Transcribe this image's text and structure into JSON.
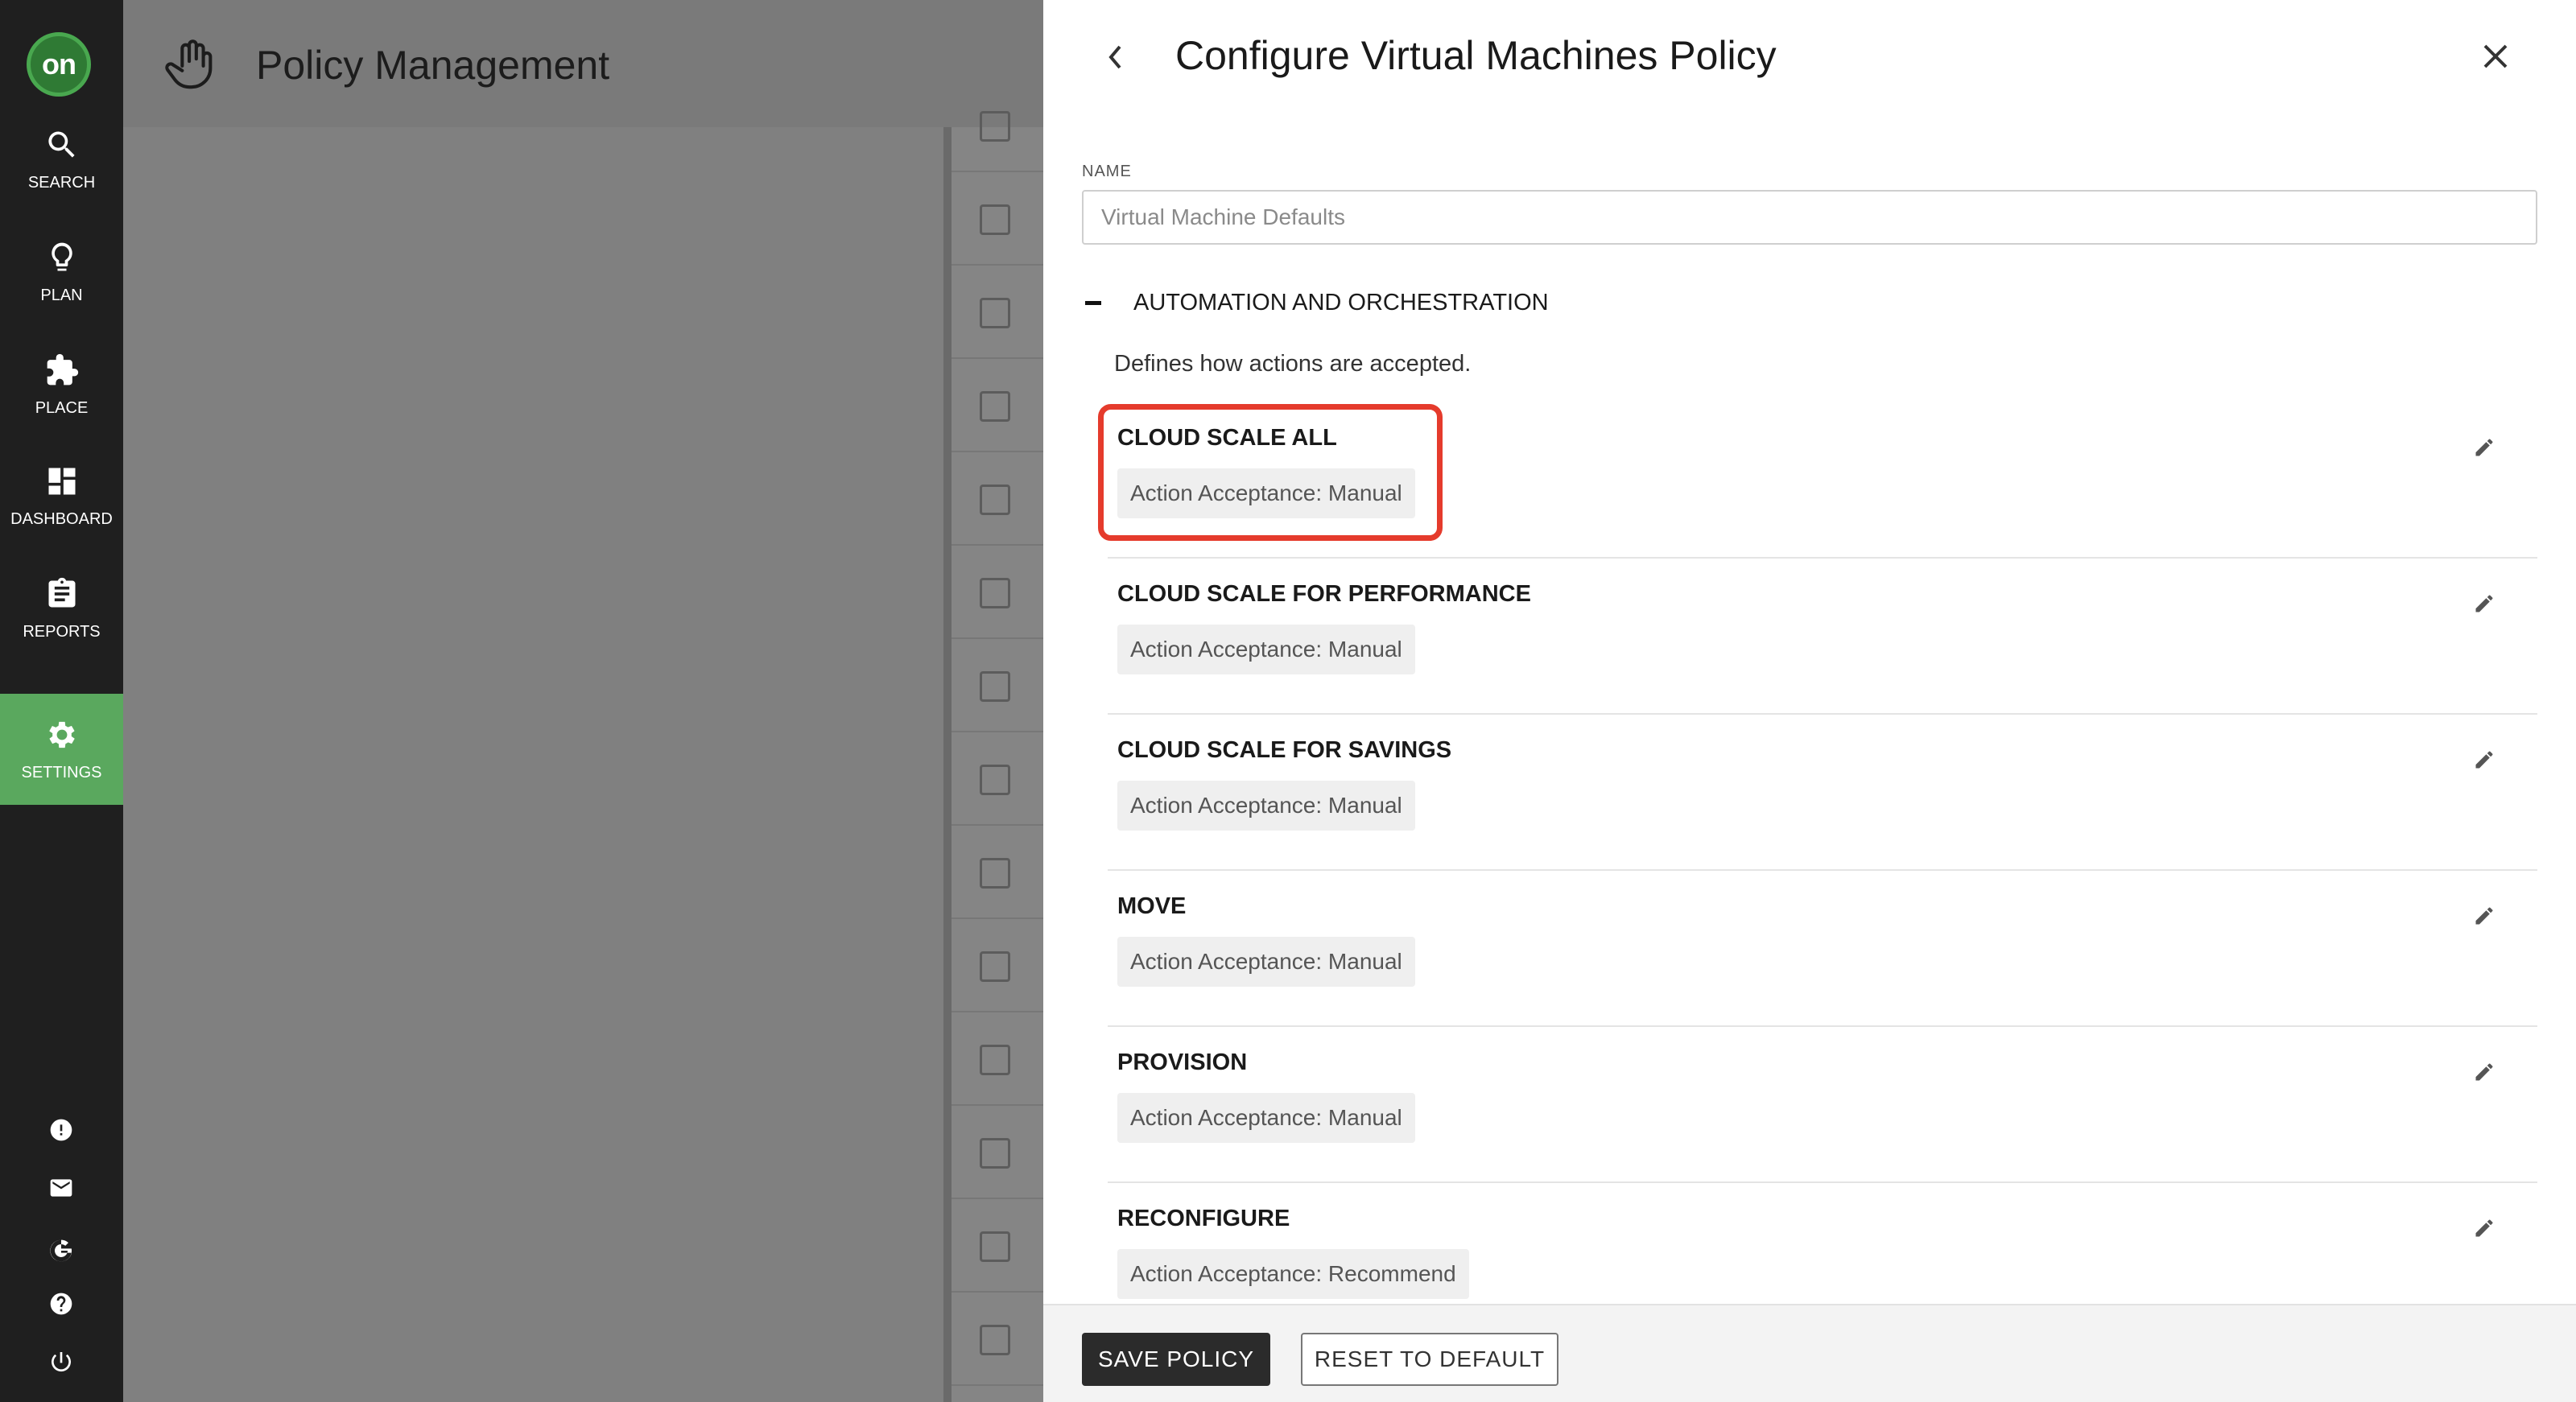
{
  "nav": {
    "logo": "on",
    "items": [
      {
        "label": "SEARCH",
        "icon": "search-icon"
      },
      {
        "label": "PLAN",
        "icon": "lightbulb-icon"
      },
      {
        "label": "PLACE",
        "icon": "puzzle-icon"
      },
      {
        "label": "DASHBOARD",
        "icon": "dashboard-icon"
      },
      {
        "label": "REPORTS",
        "icon": "clipboard-icon"
      },
      {
        "label": "SETTINGS",
        "icon": "gear-icon",
        "active": true
      }
    ],
    "utility_icons": [
      "alert-icon",
      "mail-icon",
      "google-icon",
      "help-icon",
      "power-icon"
    ]
  },
  "background": {
    "title": "Policy Management",
    "header_icon": "hand-icon"
  },
  "panel": {
    "title": "Configure Virtual Machines Policy",
    "name_label": "NAME",
    "name_placeholder": "Virtual Machine Defaults",
    "section": {
      "title": "AUTOMATION AND ORCHESTRATION",
      "description": "Defines how actions are accepted.",
      "items": [
        {
          "title": "CLOUD SCALE ALL",
          "value": "Action Acceptance: Manual"
        },
        {
          "title": "CLOUD SCALE FOR PERFORMANCE",
          "value": "Action Acceptance: Manual"
        },
        {
          "title": "CLOUD SCALE FOR SAVINGS",
          "value": "Action Acceptance: Manual"
        },
        {
          "title": "MOVE",
          "value": "Action Acceptance: Manual"
        },
        {
          "title": "PROVISION",
          "value": "Action Acceptance: Manual"
        },
        {
          "title": "RECONFIGURE",
          "value": "Action Acceptance: Recommend"
        }
      ]
    },
    "footer": {
      "save_label": "SAVE POLICY",
      "reset_label": "RESET TO DEFAULT"
    }
  },
  "colors": {
    "nav_bg": "#1f1f1f",
    "active_nav": "#5aa85e",
    "highlight": "#e53b2c",
    "save_button": "#2b2b2b"
  }
}
